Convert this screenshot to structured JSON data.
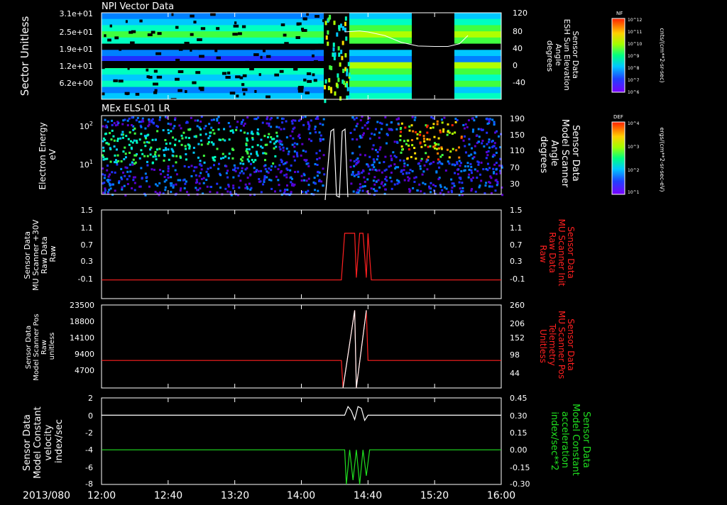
{
  "chart_data": [
    {
      "type": "heatmap",
      "title": "NPI Vector Data",
      "ylabel": "Sector Unitless",
      "yticks": [
        "3.1e+01",
        "2.5e+01",
        "1.9e+01",
        "1.2e+01",
        "6.2e+00"
      ],
      "y2label": [
        "Sensor Data",
        "ESH Sun Elevation",
        "Angle",
        "degrees"
      ],
      "y2ticks": [
        "120",
        "80",
        "40",
        "0",
        "-40"
      ],
      "colorbar": {
        "label": "NF",
        "unit": "cnts/(cm**2-sr-sec)",
        "ticks": [
          "10^12",
          "10^11",
          "10^10",
          "10^9",
          "10^8",
          "10^7",
          "10^6"
        ]
      },
      "line_series": {
        "name": "ESH Sun Elevation Angle",
        "color": "#ffffff",
        "x": [
          "14:26",
          "14:35",
          "14:40",
          "14:50",
          "15:00",
          "15:10",
          "15:20",
          "15:28",
          "15:35",
          "15:40"
        ],
        "y": [
          78,
          80,
          78,
          70,
          55,
          47,
          46,
          46,
          52,
          70
        ]
      }
    },
    {
      "type": "heatmap",
      "title": "MEx ELS-01 LR",
      "ylabel": [
        "Electron Energy",
        "eV"
      ],
      "yticks": [
        "10^2",
        "10^1"
      ],
      "y2label": [
        "Sensor Data",
        "Model Scanner",
        "Angle",
        "degrees"
      ],
      "y2ticks": [
        "190",
        "150",
        "110",
        "70",
        "30"
      ],
      "colorbar": {
        "label": "DEF",
        "unit": "ergs/(cm**2-sr-sec-eV)",
        "ticks": [
          "10^4",
          "10^3",
          "10^2",
          "10^1"
        ]
      }
    },
    {
      "type": "line",
      "ylabel": [
        "Sensor Data",
        "MU Scanner +30V",
        "Raw Data",
        "Raw"
      ],
      "yticks": [
        "1.5",
        "1.1",
        "0.7",
        "0.3",
        "-0.1"
      ],
      "ylim": [
        -0.4,
        1.5
      ],
      "y2label": [
        "Sensor Data",
        "MU Scanner Init",
        "Raw Data",
        "Raw"
      ],
      "y2ticks": [
        "1.5",
        "1.1",
        "0.7",
        "0.3",
        "-0.1"
      ],
      "series": [
        {
          "color": "#ff2020",
          "x": [
            "12:00",
            "14:24",
            "14:26",
            "14:32",
            "14:33",
            "14:35",
            "14:37",
            "14:39",
            "14:40",
            "14:42",
            "16:00"
          ],
          "y": [
            0,
            0,
            1.0,
            1.0,
            0.05,
            1.0,
            1.0,
            0.05,
            1.0,
            0,
            0
          ]
        }
      ]
    },
    {
      "type": "line",
      "ylabel": [
        "Sensor Data",
        "Model Scanner Pos",
        "Raw",
        "unitless"
      ],
      "yticks": [
        "23500",
        "18800",
        "14100",
        "9400",
        "4700"
      ],
      "ylim": [
        0,
        23500
      ],
      "y2label": [
        "Sensor Data",
        "MU Scanner Pos",
        "Telemetry",
        "Unitless"
      ],
      "y2ticks": [
        "260",
        "206",
        "152",
        "98",
        "44"
      ],
      "series": [
        {
          "color": "#ff2020",
          "x": [
            "12:00",
            "14:24",
            "14:25",
            "14:32",
            "14:33",
            "14:39",
            "14:40",
            "16:00"
          ],
          "y": [
            7800,
            7800,
            0,
            22000,
            0,
            22000,
            7800,
            7800
          ]
        },
        {
          "color": "#ffffff",
          "x": [
            "14:25",
            "14:32",
            "14:33",
            "14:39"
          ],
          "y": [
            0,
            22000,
            0,
            22000
          ]
        }
      ]
    },
    {
      "type": "line",
      "ylabel": [
        "Sensor Data",
        "Model Constant",
        "velocity",
        "index/sec"
      ],
      "yticks": [
        "2",
        "0",
        "-2",
        "-4",
        "-6",
        "-8"
      ],
      "ylim": [
        -8,
        2
      ],
      "y2label": [
        "Sensor Data",
        "Model Constant",
        "acceleration",
        "index/sec**2"
      ],
      "y2ticks": [
        "0.45",
        "0.30",
        "0.15",
        "0.00",
        "-0.15",
        "-0.30"
      ],
      "series": [
        {
          "color": "#ffffff",
          "x": [
            "12:00",
            "14:26",
            "14:28",
            "14:30",
            "14:32",
            "14:34",
            "14:36",
            "14:38",
            "14:40",
            "16:00"
          ],
          "y": [
            0,
            0,
            1,
            0.5,
            -0.5,
            1,
            0.8,
            -0.6,
            0,
            0
          ]
        },
        {
          "color": "#20e020",
          "x": [
            "12:00",
            "14:26",
            "14:27",
            "14:29",
            "14:31",
            "14:33",
            "14:35",
            "14:37",
            "14:39",
            "14:41",
            "16:00"
          ],
          "y": [
            -4,
            -4,
            -8,
            -4,
            -7.5,
            -4,
            -8,
            -4,
            -7,
            -4,
            -4
          ]
        }
      ]
    }
  ],
  "xaxis": {
    "date": "2013/080",
    "ticks": [
      "12:00",
      "12:40",
      "13:20",
      "14:00",
      "14:40",
      "15:20",
      "16:00"
    ],
    "range": [
      "12:00",
      "16:00"
    ]
  },
  "colors": {
    "background": "#000000",
    "axis": "#ffffff",
    "red_label": "#ff2020",
    "green_label": "#20e020"
  }
}
